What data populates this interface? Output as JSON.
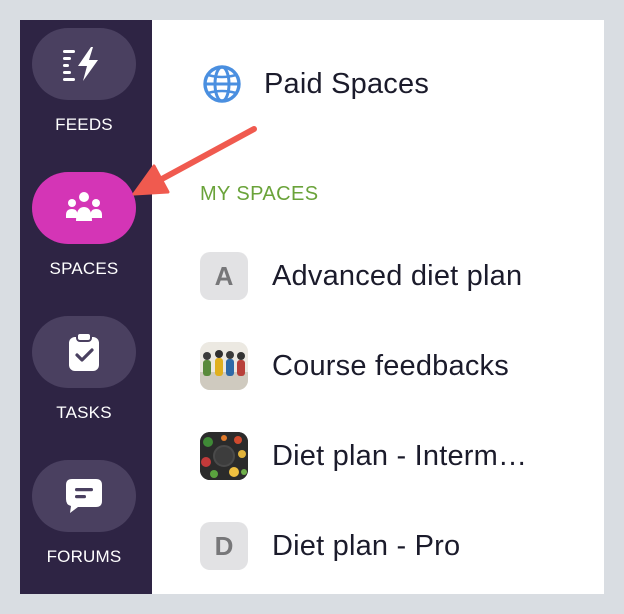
{
  "sidebar": {
    "items": [
      {
        "label": "FEEDS",
        "icon": "feeds-bolt-icon",
        "active": false
      },
      {
        "label": "SPACES",
        "icon": "spaces-people-icon",
        "active": true
      },
      {
        "label": "TASKS",
        "icon": "clipboard-check-icon",
        "active": false
      },
      {
        "label": "FORUMS",
        "icon": "chat-bubble-icon",
        "active": false
      }
    ],
    "active_color": "#d435b6",
    "background": "#2e2444"
  },
  "main": {
    "paid_spaces": {
      "label": "Paid Spaces",
      "icon": "globe-icon"
    },
    "section_title": "MY SPACES",
    "spaces": [
      {
        "label": "Advanced diet plan",
        "avatar": "A",
        "avatar_type": "letter"
      },
      {
        "label": "Course feedbacks",
        "avatar": "",
        "avatar_type": "photo"
      },
      {
        "label": "Diet plan - Interm…",
        "avatar": "",
        "avatar_type": "photo"
      },
      {
        "label": "Diet plan - Pro",
        "avatar": "D",
        "avatar_type": "letter"
      }
    ]
  },
  "annotation": {
    "type": "arrow",
    "color": "#f05a4f",
    "points_to": "SPACES"
  }
}
